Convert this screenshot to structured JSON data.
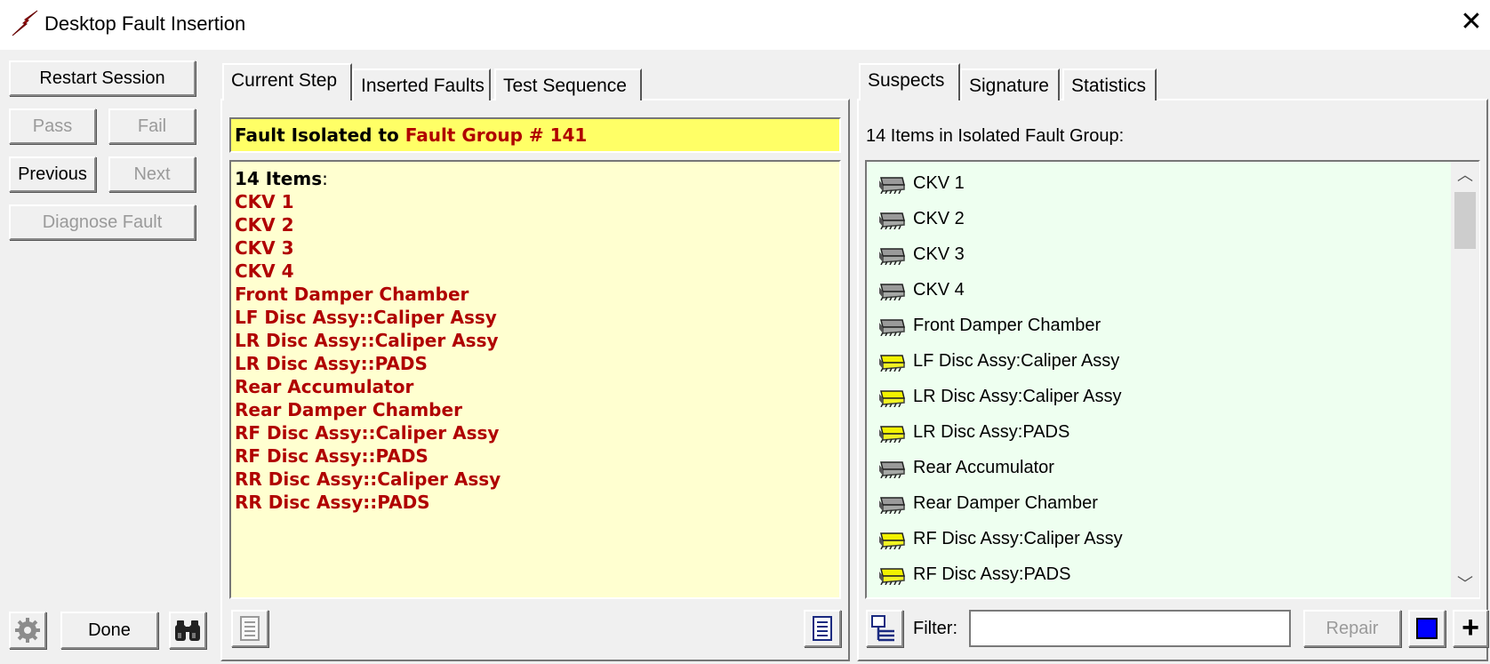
{
  "window": {
    "title": "Desktop Fault Insertion",
    "close_glyph": "✕"
  },
  "left": {
    "restart": "Restart Session",
    "pass": "Pass",
    "fail": "Fail",
    "previous": "Previous",
    "next": "Next",
    "diagnose": "Diagnose Fault",
    "done": "Done"
  },
  "center": {
    "tabs": [
      "Current Step",
      "Inserted Faults",
      "Test Sequence"
    ],
    "active_tab": "Current Step",
    "banner_prefix": "Fault Isolated to ",
    "banner_group": "Fault Group # 141",
    "items_header_count": "14 Items",
    "items_header_colon": ":",
    "items": [
      "CKV 1",
      "CKV 2",
      "CKV 3",
      "CKV 4",
      "Front Damper Chamber",
      "LF Disc Assy::Caliper Assy",
      "LR Disc Assy::Caliper Assy",
      "LR Disc Assy::PADS",
      "Rear Accumulator",
      "Rear Damper Chamber",
      "RF Disc Assy::Caliper Assy",
      "RF Disc Assy::PADS",
      "RR Disc Assy::Caliper Assy",
      "RR Disc Assy::PADS"
    ]
  },
  "right": {
    "tabs": [
      "Suspects",
      "Signature",
      "Statistics"
    ],
    "active_tab": "Suspects",
    "group_label": "14 Items in Isolated Fault Group:",
    "suspects": [
      {
        "name": "CKV 1",
        "color": "gray"
      },
      {
        "name": "CKV 2",
        "color": "gray"
      },
      {
        "name": "CKV 3",
        "color": "gray"
      },
      {
        "name": "CKV 4",
        "color": "gray"
      },
      {
        "name": "Front Damper Chamber",
        "color": "gray"
      },
      {
        "name": "LF Disc Assy:Caliper Assy",
        "color": "yellow"
      },
      {
        "name": "LR Disc Assy:Caliper Assy",
        "color": "yellow"
      },
      {
        "name": "LR Disc Assy:PADS",
        "color": "yellow"
      },
      {
        "name": "Rear Accumulator",
        "color": "gray"
      },
      {
        "name": "Rear Damper Chamber",
        "color": "gray"
      },
      {
        "name": "RF Disc Assy:Caliper Assy",
        "color": "yellow"
      },
      {
        "name": "RF Disc Assy:PADS",
        "color": "yellow"
      }
    ],
    "filter_label": "Filter:",
    "filter_value": "",
    "repair": "Repair"
  },
  "colors": {
    "fault_red": "#b00000",
    "banner_yellow": "#ffff66",
    "list_yellow": "#ffffd0",
    "suspect_green": "#eefff0",
    "chip_gray": "#9a9a9a",
    "chip_yellow": "#f2f200",
    "swatch_blue": "#0000ff"
  }
}
